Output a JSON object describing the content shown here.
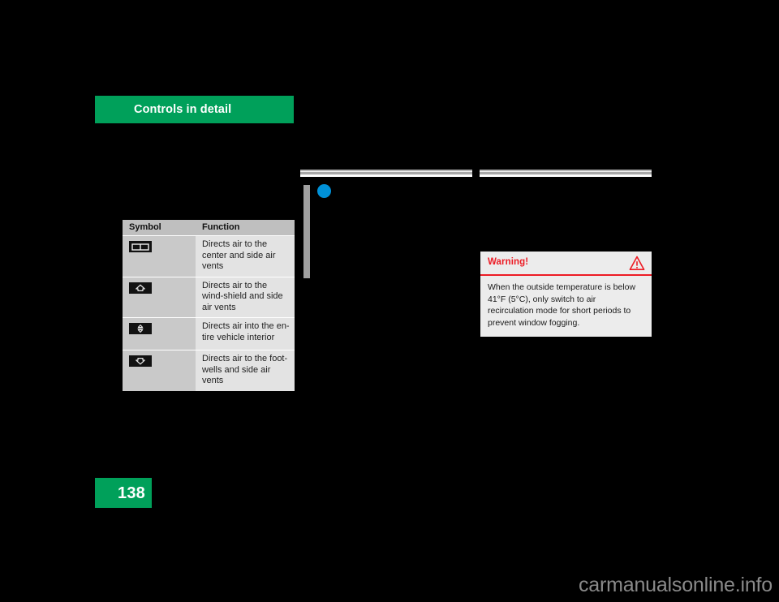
{
  "document": {
    "chapter_title": "Controls in detail",
    "page_number": "138",
    "footer_watermark": "carmanualsonline.info"
  },
  "theme": {
    "chapter_green": "#00a05a",
    "warning_red": "#ed1b24",
    "marker_blue": "#0091d8",
    "table_header_grey": "#bfbfbf",
    "table_symbol_grey": "#c9c9c9",
    "table_function_grey": "#e3e3e3",
    "warning_box_grey": "#ececec",
    "page_black": "#000000"
  },
  "symbol_table": {
    "headers": {
      "symbol": "Symbol",
      "function": "Function"
    },
    "rows": [
      {
        "icon": "center-vents-icon",
        "function": "Directs air to the center and side air vents"
      },
      {
        "icon": "windshield-defrost-icon",
        "function": "Directs air to the wind-shield and side air vents"
      },
      {
        "icon": "bi-level-all-vents-icon",
        "function": "Directs air into the en-tire vehicle interior"
      },
      {
        "icon": "footwell-vents-icon",
        "function": "Directs air to the foot-wells and side air vents"
      }
    ]
  },
  "warning": {
    "title": "Warning!",
    "icon": "warning-triangle-icon",
    "body": "When the outside temperature is below 41°F (5°C), only switch to air recirculation mode for short periods to prevent window fogging."
  },
  "margin_marker": {
    "bar": "change-bar",
    "bullet": "blue-bullet-marker"
  }
}
